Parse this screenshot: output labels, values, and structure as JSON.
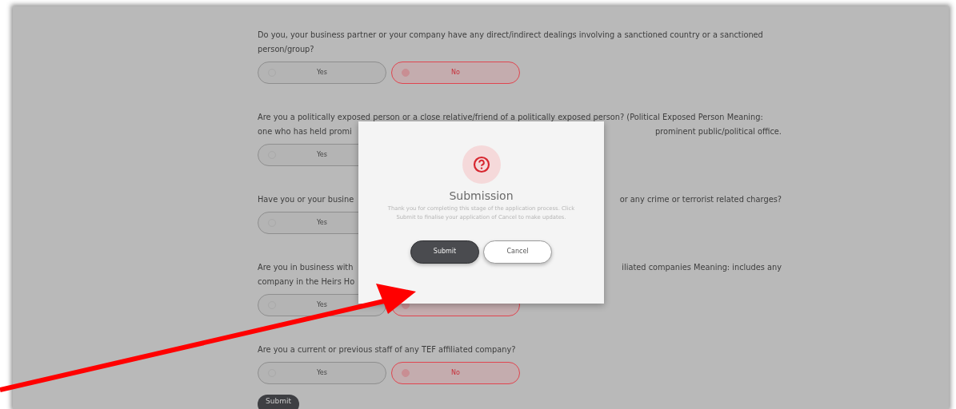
{
  "questions": [
    {
      "lines": [
        [
          "Do you, your business partner or your company have any direct/indirect dealings involving a sanctioned country or a sanctioned"
        ],
        [
          "person/group?"
        ]
      ],
      "options": [
        {
          "label": "Yes",
          "selected": false
        },
        {
          "label": "No",
          "selected": true
        }
      ]
    },
    {
      "lines": [
        [
          "Are you a politically exposed person or a close relative/friend of a politically exposed person? (Political Exposed Person Meaning:"
        ],
        [
          "one who has held promi",
          "prominent public/political office."
        ]
      ],
      "options": [
        {
          "label": "Yes",
          "selected": false
        }
      ]
    },
    {
      "lines": [
        [
          "Have you or your busine",
          "or any crime or terrorist related charges?"
        ]
      ],
      "options": [
        {
          "label": "Yes",
          "selected": false
        }
      ]
    },
    {
      "lines": [
        [
          "Are you in business with",
          "iliated companies Meaning: includes any"
        ],
        [
          "company in the Heirs Ho"
        ]
      ],
      "options": [
        {
          "label": "Yes",
          "selected": false
        },
        {
          "selected": true
        }
      ]
    },
    {
      "lines": [
        [
          "Are you a current or previous staff of any TEF affiliated company?"
        ]
      ],
      "options": [
        {
          "label": "Yes",
          "selected": false
        },
        {
          "label": "No",
          "selected": true
        }
      ]
    }
  ],
  "submit_label": "Submit",
  "modal": {
    "title": "Submission",
    "message": "Thank you for completing this stage of the application process. Click Submit to finalise your application of Cancel to make updates.",
    "buttons": [
      {
        "label": "Submit",
        "kind": "primary"
      },
      {
        "label": "Cancel",
        "kind": "secondary"
      }
    ]
  }
}
